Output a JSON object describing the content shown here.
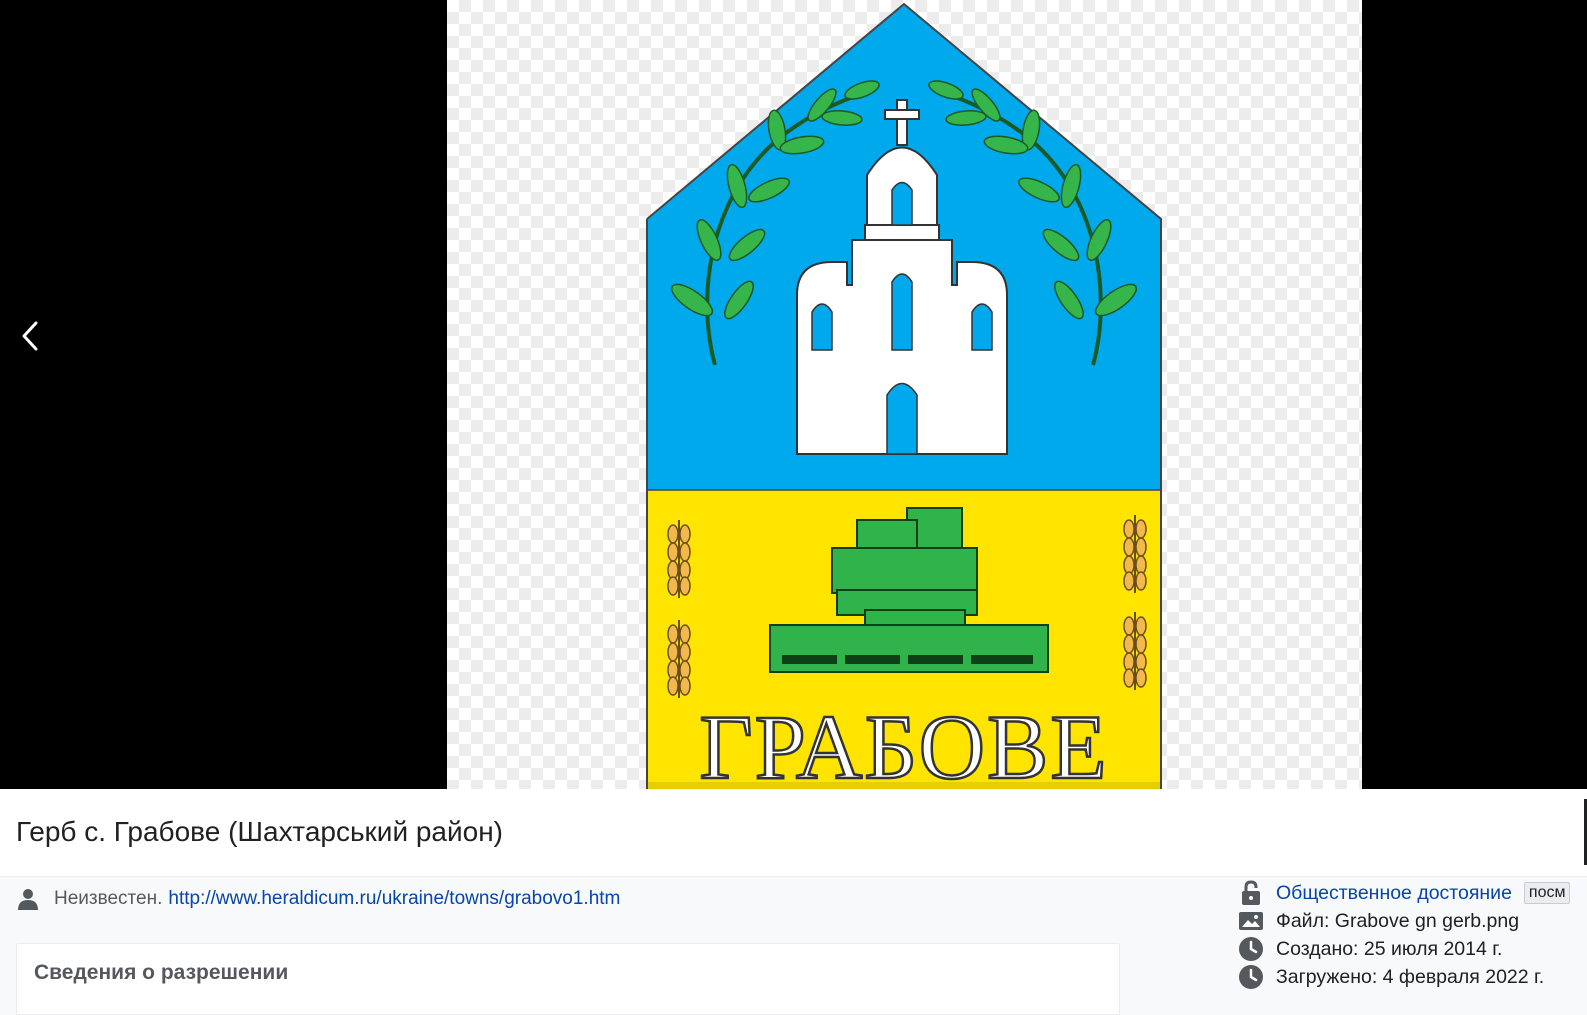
{
  "image": {
    "coat_of_arms_text": "ГРАБОВЕ"
  },
  "title_bar": {
    "title": "Герб с. Грабове (Шахтарський район)"
  },
  "author": {
    "label": "Неизвестен.",
    "source_url": "http://www.heraldicum.ru/ukraine/towns/grabovo1.htm"
  },
  "license_box": {
    "title": "Сведения о разрешении"
  },
  "meta": {
    "license": "Общественное достояние",
    "more_badge": "посм",
    "file": "Файл: Grabove gn gerb.png",
    "created": "Создано: 25 июля 2014 г.",
    "uploaded": "Загружено: 4 февраля 2022 г."
  },
  "icons": {
    "prev": "chevron-left-icon",
    "author": "user-icon",
    "license": "unlock-icon",
    "file": "image-icon",
    "created": "clock-icon",
    "uploaded": "clock-icon"
  },
  "colors": {
    "shield_blue": "#00a8ec",
    "shield_yellow": "#ffe400",
    "green": "#2fb34a",
    "link": "#0645ad"
  }
}
